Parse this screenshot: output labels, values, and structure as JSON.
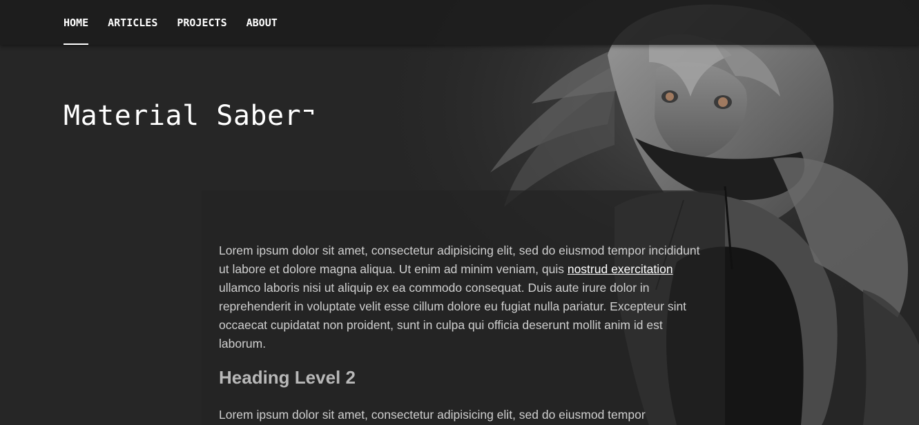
{
  "nav": {
    "items": [
      {
        "label": "HOME",
        "active": true
      },
      {
        "label": "ARTICLES",
        "active": false
      },
      {
        "label": "PROJECTS",
        "active": false
      },
      {
        "label": "ABOUT",
        "active": false
      }
    ]
  },
  "hero": {
    "title": "Material Saber"
  },
  "article": {
    "para1_before": "Lorem ipsum dolor sit amet, consectetur adipisicing elit, sed do eiusmod tempor incididunt ut labore et dolore magna aliqua. Ut enim ad minim veniam, quis ",
    "para1_link": "nostrud exercitation",
    "para1_after": " ullamco laboris nisi ut aliquip ex ea commodo consequat. Duis aute irure dolor in reprehenderit in voluptate velit esse cillum dolore eu fugiat nulla pariatur. Excepteur sint occaecat cupidatat non proident, sunt in culpa qui officia deserunt mollit anim id est laborum.",
    "heading2": "Heading Level 2",
    "para2": "Lorem ipsum dolor sit amet, consectetur adipisicing elit, sed do eiusmod tempor"
  },
  "colors": {
    "background": "#262626",
    "navbar": "#1c1c1c",
    "text": "#cfcfcf",
    "heading": "#b8b8b8",
    "accent": "#ffffff"
  }
}
